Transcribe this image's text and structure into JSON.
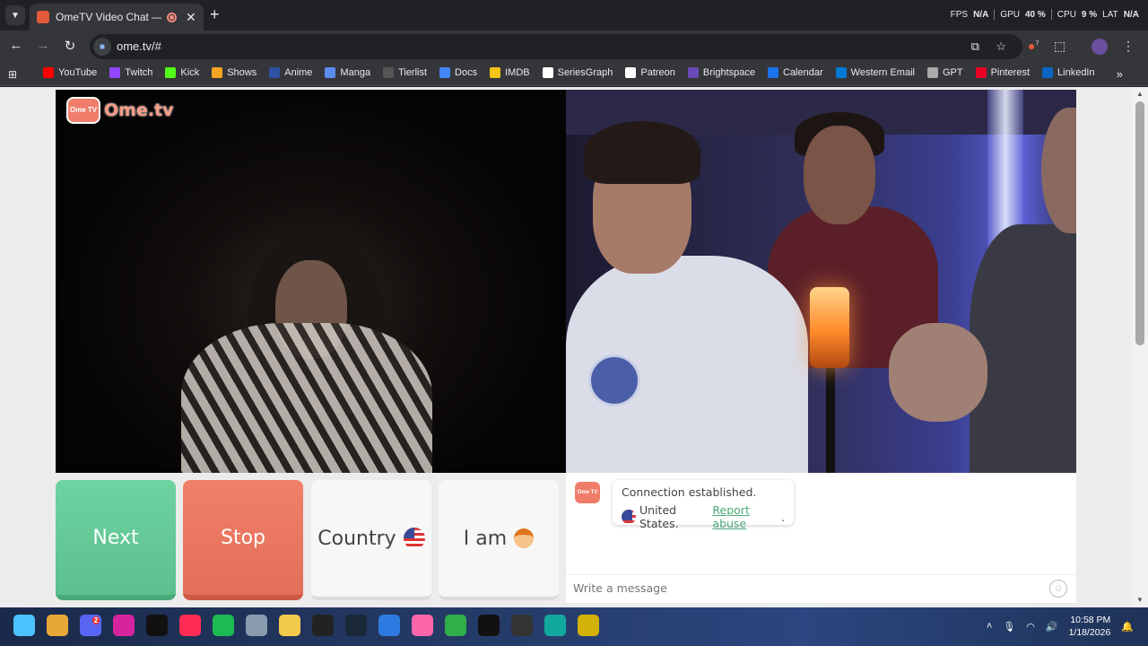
{
  "browser": {
    "tab_title": "OmeTV Video Chat — Ome",
    "url": "ome.tv/#",
    "perf": {
      "fps_label": "FPS",
      "fps_value": "N/A",
      "gpu_label": "GPU",
      "gpu_value": "40 %",
      "cpu_label": "CPU",
      "cpu_value": "9 %",
      "lat_label": "LAT",
      "lat_value": "N/A"
    },
    "extension_badge": "7"
  },
  "bookmarks": [
    {
      "label": "YouTube",
      "color": "#ff0000"
    },
    {
      "label": "Twitch",
      "color": "#9146ff"
    },
    {
      "label": "Kick",
      "color": "#53fc18"
    },
    {
      "label": "Shows",
      "color": "#f5a623"
    },
    {
      "label": "Anime",
      "color": "#2e51a2"
    },
    {
      "label": "Manga",
      "color": "#5b8def"
    },
    {
      "label": "Tierlist",
      "color": "#555555"
    },
    {
      "label": "Docs",
      "color": "#4285f4"
    },
    {
      "label": "IMDB",
      "color": "#f5c518"
    },
    {
      "label": "SeriesGraph",
      "color": "#ffffff"
    },
    {
      "label": "Patreon",
      "color": "#ffffff"
    },
    {
      "label": "Brightspace",
      "color": "#6c4ab6"
    },
    {
      "label": "Calendar",
      "color": "#1a73e8"
    },
    {
      "label": "Western Email",
      "color": "#0078d4"
    },
    {
      "label": "GPT",
      "color": "#aaaaaa"
    },
    {
      "label": "Pinterest",
      "color": "#e60023"
    },
    {
      "label": "LinkedIn",
      "color": "#0a66c2"
    }
  ],
  "ometv": {
    "brand_badge": "Ome TV",
    "brand_text": "Ome.tv",
    "buttons": {
      "next": "Next",
      "stop": "Stop",
      "country": "Country",
      "i_am": "I am"
    },
    "chat": {
      "status": "Connection established.",
      "country": "United States.",
      "report": "Report abuse",
      "report_suffix": ".",
      "placeholder": "Write a message"
    }
  },
  "taskbar": {
    "apps": [
      {
        "name": "start-icon",
        "color": "#4cc2ff"
      },
      {
        "name": "chrome-icon",
        "color": "#e8a838"
      },
      {
        "name": "discord-icon",
        "color": "#5865f2",
        "badge": "2"
      },
      {
        "name": "instagram-icon",
        "color": "#d6249f"
      },
      {
        "name": "tiktok-icon",
        "color": "#111111"
      },
      {
        "name": "tiktok-alt-icon",
        "color": "#fe2c55"
      },
      {
        "name": "spotify-icon",
        "color": "#1db954"
      },
      {
        "name": "settings-icon",
        "color": "#8a9bb0"
      },
      {
        "name": "file-explorer-icon",
        "color": "#f2c94c"
      },
      {
        "name": "epic-games-icon",
        "color": "#222222"
      },
      {
        "name": "steam-icon",
        "color": "#1b2838"
      },
      {
        "name": "app-store-icon",
        "color": "#2d7be0"
      },
      {
        "name": "osu-icon",
        "color": "#ff66aa"
      },
      {
        "name": "riot-icon",
        "color": "#2fae4a"
      },
      {
        "name": "capcut-icon",
        "color": "#111111"
      },
      {
        "name": "capcut-alt-icon",
        "color": "#333333"
      },
      {
        "name": "media-icon",
        "color": "#13a89e"
      },
      {
        "name": "obs-icon",
        "color": "#d4b106"
      }
    ],
    "time": "10:58 PM",
    "date": "1/18/2026"
  }
}
